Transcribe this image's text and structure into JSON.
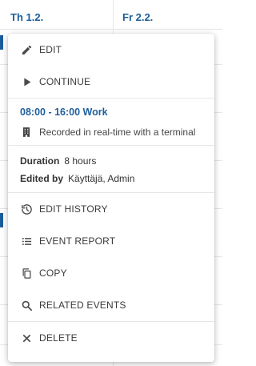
{
  "calendar": {
    "day_1": "Th 1.2.",
    "day_2": "Fr 2.2."
  },
  "menu": {
    "edit": "EDIT",
    "continue": "CONTINUE",
    "event_title": "08:00 - 16:00 Work",
    "event_source": "Recorded in real-time with a terminal",
    "duration_label": "Duration",
    "duration_value": "8 hours",
    "edited_by_label": "Edited by",
    "edited_by_value": "Käyttäjä, Admin",
    "edit_history": "EDIT HISTORY",
    "event_report": "EVENT REPORT",
    "copy": "COPY",
    "related_events": "RELATED EVENTS",
    "delete": "DELETE"
  },
  "colors": {
    "accent": "#1f5f9e"
  }
}
